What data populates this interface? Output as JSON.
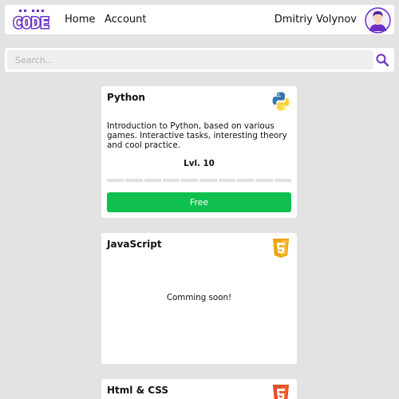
{
  "header": {
    "nav": {
      "home": "Home",
      "account": "Account"
    },
    "user_name": "Dmitriy Volynov"
  },
  "search": {
    "placeholder": "Search..."
  },
  "courses": [
    {
      "title": "Python",
      "icon": "python-icon",
      "description": "Introduction to Python, based on various games. Interactive tasks, interesting theory and cool practice.",
      "level": "Lvl. 10",
      "progress_segments": 10,
      "button_label": "Free"
    },
    {
      "title": "JavaScript",
      "icon": "javascript-icon",
      "status": "Comming soon!"
    },
    {
      "title": "Html & CSS",
      "icon": "html5-icon"
    }
  ],
  "colors": {
    "accent": "#6a2fc6",
    "free_button": "#0fc050",
    "background": "#e3e3e3"
  }
}
